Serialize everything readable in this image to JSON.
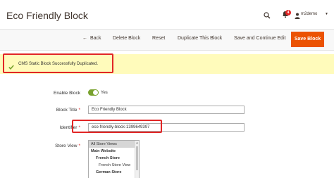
{
  "page": {
    "title": "Eco Friendly Block"
  },
  "header": {
    "notification_count": "4",
    "user_name": "m2demo",
    "icons": [
      "search-icon",
      "bell-icon",
      "user-icon",
      "caret-down-icon"
    ]
  },
  "toolbar": {
    "back_label": "Back",
    "delete_label": "Delete Block",
    "reset_label": "Reset",
    "duplicate_label": "Duplicate This Block",
    "save_continue_label": "Save and Continue Edit",
    "save_label": "Save Block"
  },
  "message": {
    "text": "CMS Static Block Successfully Duplicated.",
    "type": "success"
  },
  "form": {
    "enable_block": {
      "label": "Enable Block",
      "value_text": "Yes",
      "enabled": true
    },
    "block_title": {
      "label": "Block Title",
      "value": "Eco Friendly Block",
      "required": "*"
    },
    "identifier": {
      "label": "Identifier",
      "value": "eco-friendly-block-1399649397",
      "required": "*"
    },
    "store_view": {
      "label": "Store View",
      "required": "*",
      "options": [
        {
          "label": "All Store Views",
          "selected": true
        },
        {
          "label": "Main Website",
          "bold": true
        },
        {
          "label": "French Store",
          "bold": true
        },
        {
          "label": "French Store View"
        },
        {
          "label": "German Store",
          "bold": true
        }
      ]
    }
  },
  "colors": {
    "accent": "#eb5202",
    "message_bg": "#fffbbb",
    "toggle_on": "#79a22e",
    "highlight_border": "#e22626"
  }
}
